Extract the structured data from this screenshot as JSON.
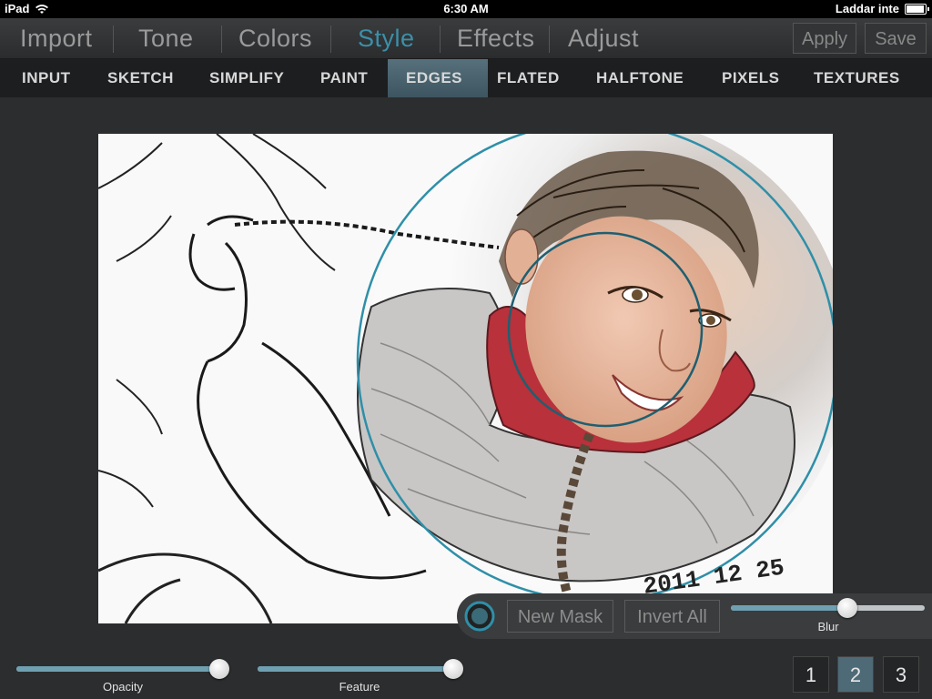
{
  "statusbar": {
    "device": "iPad",
    "time": "6:30 AM",
    "charging": "Laddar inte"
  },
  "main_tabs": [
    "Import",
    "Tone",
    "Colors",
    "Style",
    "Effects",
    "Adjust"
  ],
  "active_main_tab": "Style",
  "top_buttons": {
    "apply": "Apply",
    "save": "Save"
  },
  "sub_tabs": [
    "INPUT",
    "SKETCH",
    "SIMPLIFY",
    "PAINT",
    "EDGES",
    "FLATED",
    "HALFTONE",
    "PIXELS",
    "TEXTURES"
  ],
  "active_sub_tab": "EDGES",
  "photo": {
    "date_stamp": "2011 12 25"
  },
  "mask_panel": {
    "new_mask": "New Mask",
    "invert_all": "Invert All",
    "blur": {
      "label": "Blur",
      "value": 0.6
    }
  },
  "bottom": {
    "opacity": {
      "label": "Opacity",
      "value": 0.96
    },
    "feature": {
      "label": "Feature",
      "value": 0.96
    },
    "pages": [
      "1",
      "2",
      "3"
    ],
    "active_page": "2"
  },
  "colors": {
    "accent": "#3d8fa8",
    "active_subtab": "#4d6a76"
  }
}
